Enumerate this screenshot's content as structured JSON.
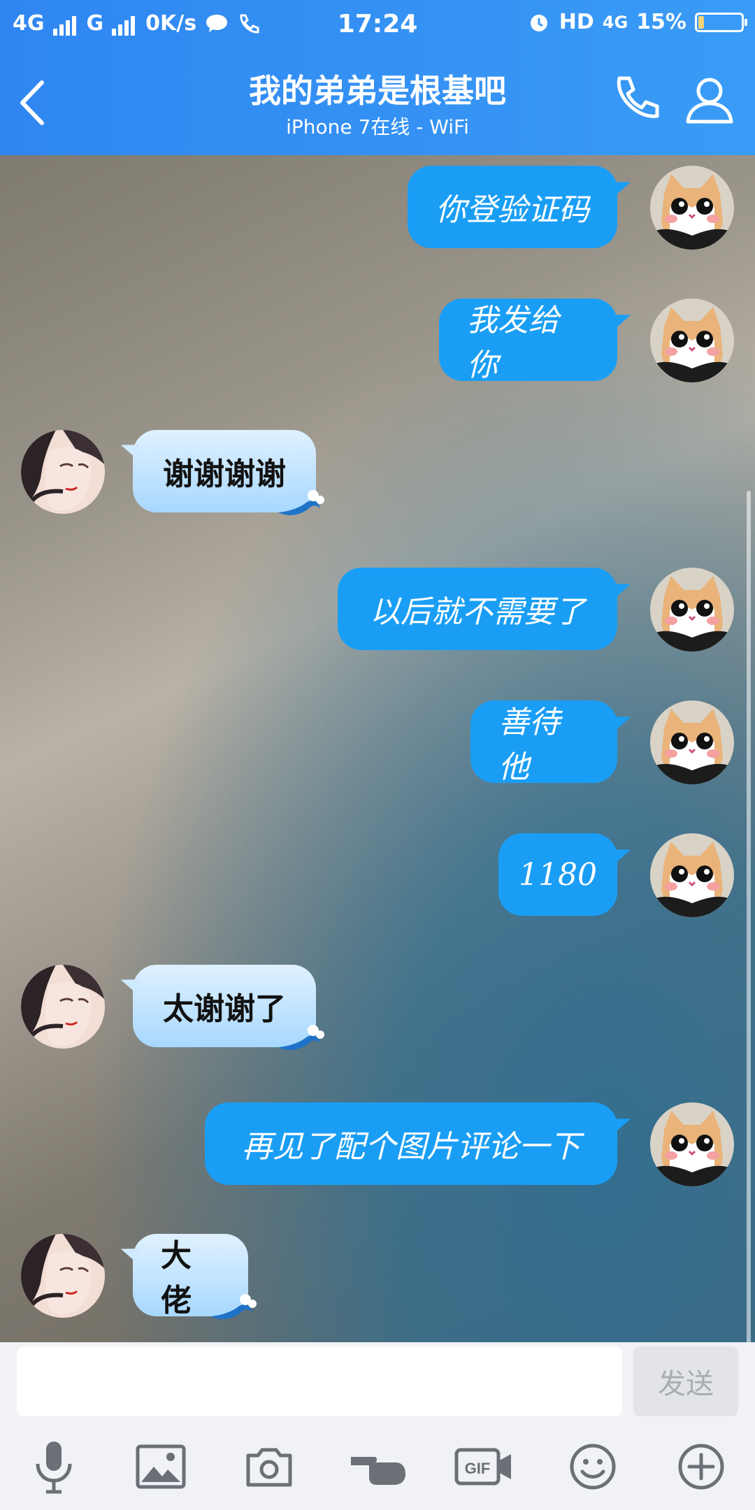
{
  "status_bar": {
    "network1": "4G",
    "network2": "G",
    "speed": "0K/s",
    "time": "17:24",
    "hd": "HD",
    "net_4g": "4G",
    "battery": "15%"
  },
  "header": {
    "title": "我的弟弟是根基吧",
    "subtitle": "iPhone 7在线 - WiFi"
  },
  "messages": [
    {
      "from": "me",
      "text": "你登验证码"
    },
    {
      "from": "me",
      "text": "我发给你"
    },
    {
      "from": "them",
      "text": "谢谢谢谢"
    },
    {
      "from": "me",
      "text": "以后就不需要了"
    },
    {
      "from": "me",
      "text": "善待他"
    },
    {
      "from": "me",
      "text": "1180"
    },
    {
      "from": "them",
      "text": "太谢谢了"
    },
    {
      "from": "me",
      "text": "再见了配个图片评论一下"
    },
    {
      "from": "them",
      "text": "大佬"
    }
  ],
  "input": {
    "placeholder": "",
    "send_label": "发送"
  },
  "toolbar": {
    "icons": [
      "microphone-icon",
      "image-icon",
      "camera-icon",
      "poke-icon",
      "gif-icon",
      "emoji-icon",
      "plus-icon"
    ],
    "gif_label": "GIF"
  },
  "colors": {
    "header_blue": "#3a9cf6",
    "my_bubble": "#1a9ef5",
    "their_bubble": "#bfe3ff"
  }
}
